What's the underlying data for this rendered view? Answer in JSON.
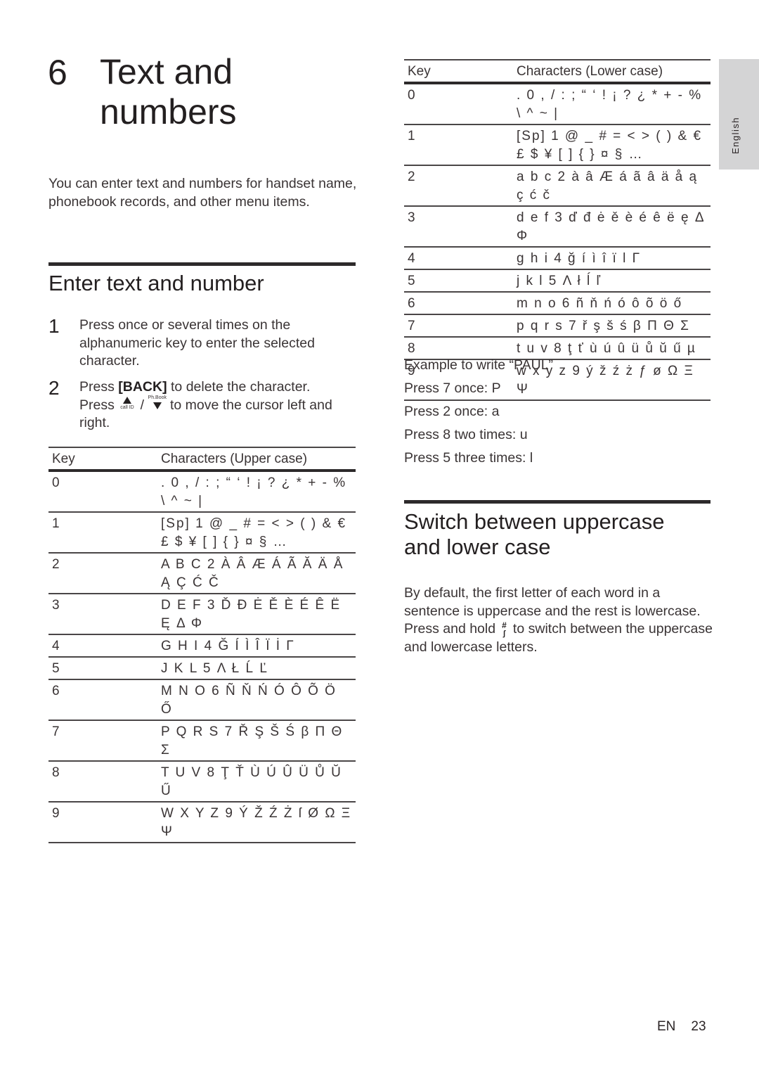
{
  "chapter": {
    "number": "6",
    "title_line1": "Text and",
    "title_line2": "numbers",
    "intro": "You can enter text and numbers for handset name, phonebook records, and other menu items."
  },
  "section_enter": {
    "title": "Enter text and number",
    "steps": [
      {
        "num": "1",
        "text": "Press once or several times on the alphanumeric key to enter the selected character."
      },
      {
        "num": "2",
        "text_a": "Press ",
        "bold": "[BACK]",
        "text_b": " to delete the character.",
        "text_c": "Press ",
        "icon_left_label": "call ID",
        "separator": " / ",
        "icon_right_label": "Ph.Book",
        "text_d": " to move the cursor left and right."
      }
    ]
  },
  "upper_table": {
    "headers": [
      "Key",
      "Characters (Upper case)"
    ],
    "rows": [
      {
        "key": "0",
        "chars": ". 0 , / : ; “ ‘ ! ¡ ? ¿ * + - % \\ ^ ~ |"
      },
      {
        "key": "1",
        "chars": "[Sp] 1 @ _ # = < > ( ) & € £ $ ¥ [ ] { } ¤ § …"
      },
      {
        "key": "2",
        "chars": "A B C 2 À Â Æ Á Ã Ă Ä Å Ą Ç Ć Č"
      },
      {
        "key": "3",
        "chars": "D E F 3 Ď Đ Ė Ě È É Ê Ë Ę Δ Φ"
      },
      {
        "key": "4",
        "chars": "G H I 4 Ğ Í Ì Î Ï İ Γ"
      },
      {
        "key": "5",
        "chars": "J K L 5 Λ Ł Ĺ Ľ"
      },
      {
        "key": "6",
        "chars": "M N O 6 Ñ Ň Ń Ó Ô Õ Ö Ő"
      },
      {
        "key": "7",
        "chars": "P Q R S 7 Ř Ş Š Ś β Π Θ Σ"
      },
      {
        "key": "8",
        "chars": "T U V 8 Ţ Ť Ù Ú Û Ü Ů Ŭ Ű"
      },
      {
        "key": "9",
        "chars": "W X Y Z 9 Ý Ž Ź Ż ſ Ø Ω Ξ Ψ"
      }
    ]
  },
  "lower_table": {
    "headers": [
      "Key",
      "Characters (Lower case)"
    ],
    "rows": [
      {
        "key": "0",
        "chars": ". 0 , / : ; “ ‘ ! ¡ ? ¿ * + - % \\ ^ ~ |"
      },
      {
        "key": "1",
        "chars": "[Sp] 1 @ _ # = < > ( ) & € £ $ ¥ [ ] { } ¤ § …"
      },
      {
        "key": "2",
        "chars": "a b c 2 à â Æ á ã â ä å ą ç ć č"
      },
      {
        "key": "3",
        "chars": "d e f 3 ď đ ė ě è é ê ë ę Δ Φ"
      },
      {
        "key": "4",
        "chars": "g h i 4 ğ í ì î ï l Γ"
      },
      {
        "key": "5",
        "chars": "j k l 5 Λ ł ĺ ľ"
      },
      {
        "key": "6",
        "chars": "m n o 6 ñ ň ń ó ô õ ö ő"
      },
      {
        "key": "7",
        "chars": "p q r s 7 ř ş š ś β Π Θ Σ"
      },
      {
        "key": "8",
        "chars": "t u v 8 ţ ť ù ú û ü ů ŭ ű µ"
      },
      {
        "key": "9",
        "chars": "w x y z 9 ý ž ź ż ƒ ø Ω Ξ Ψ"
      }
    ]
  },
  "example": {
    "title": "Example to write “PAUL”",
    "lines": [
      "Press 7 once: P",
      "Press 2 once: a",
      "Press 8 two times: u",
      "Press 5 three times: l"
    ]
  },
  "section_switch": {
    "title_line1": "Switch between uppercase",
    "title_line2": "and lower case",
    "text_a": "By default, the first letter of each word in a sentence is uppercase and the rest is lowercase. Press and hold ",
    "icon_label": "#",
    "text_b": " to switch between the uppercase and lowercase letters."
  },
  "side_tab": {
    "label": "English"
  },
  "footer": {
    "lang": "EN",
    "page": "23"
  }
}
